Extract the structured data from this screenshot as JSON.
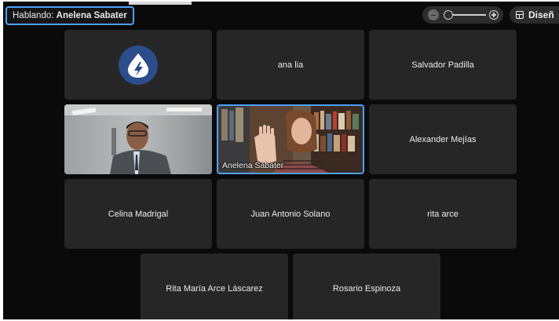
{
  "top_bar": {
    "speaking_prefix": "Hablando:",
    "speaking_name": "Anelena Sabater",
    "layout_label": "Diseñ"
  },
  "icons": {
    "zoom_out": "zoom-out-icon",
    "zoom_in": "zoom-in-icon",
    "layout": "grid-layout-icon",
    "logo": "flame-bolt-logo"
  },
  "colors": {
    "accent": "#4ea1ff",
    "tile_bg": "#262626",
    "stage_bg": "#0a0a0a"
  },
  "participants": [
    {
      "id": "logo",
      "name": "",
      "kind": "logo"
    },
    {
      "id": "ana-lia",
      "name": "ana lia",
      "kind": "name"
    },
    {
      "id": "salvador-padilla",
      "name": "Salvador Padilla",
      "kind": "name"
    },
    {
      "id": "video-man",
      "name": "",
      "kind": "video"
    },
    {
      "id": "anelena-sabater",
      "name": "Anelena Sabater",
      "kind": "video",
      "active": true
    },
    {
      "id": "alexander-mejias",
      "name": "Alexander Mejías",
      "kind": "name"
    },
    {
      "id": "celina-madrigal",
      "name": "Celina Madrigal",
      "kind": "name"
    },
    {
      "id": "juan-antonio-solano",
      "name": "Juan Antonio Solano",
      "kind": "name"
    },
    {
      "id": "rita-arce",
      "name": "rita arce",
      "kind": "name"
    },
    {
      "id": "rita-maria-arce-lascarez",
      "name": "Rita María Arce Láscarez",
      "kind": "name"
    },
    {
      "id": "rosario-espinoza",
      "name": "Rosario Espinoza",
      "kind": "name"
    }
  ]
}
